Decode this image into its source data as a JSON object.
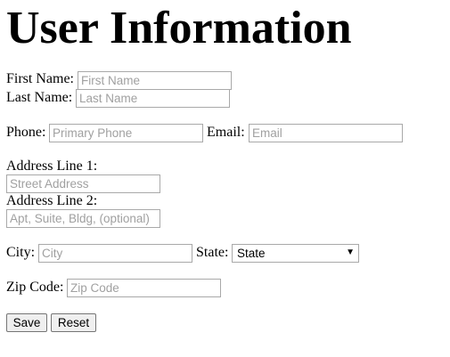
{
  "page": {
    "title": "User Information"
  },
  "form": {
    "first_name": {
      "label": "First Name:",
      "placeholder": "First Name",
      "value": ""
    },
    "last_name": {
      "label": "Last Name:",
      "placeholder": "Last Name",
      "value": ""
    },
    "phone": {
      "label": "Phone:",
      "placeholder": "Primary Phone",
      "value": ""
    },
    "email": {
      "label": "Email:",
      "placeholder": "Email",
      "value": ""
    },
    "address1": {
      "label": "Address Line 1:",
      "placeholder": "Street Address",
      "value": ""
    },
    "address2": {
      "label": "Address Line 2:",
      "placeholder": "Apt, Suite, Bldg, (optional)",
      "value": ""
    },
    "city": {
      "label": "City:",
      "placeholder": "City",
      "value": ""
    },
    "state": {
      "label": "State:",
      "selected": "State"
    },
    "zip": {
      "label": "Zip Code:",
      "placeholder": "Zip Code",
      "value": ""
    }
  },
  "buttons": {
    "save_label": "Save",
    "reset_label": "Reset"
  }
}
